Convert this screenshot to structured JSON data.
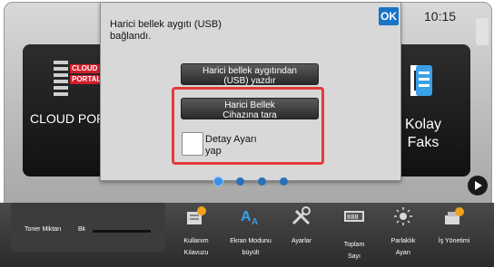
{
  "clock": "10:15",
  "tiles": {
    "cloud_logo_line1": "CLOUD",
    "cloud_logo_line2": "PORTAL",
    "cloud_label": "CLOUD POR",
    "fax_label_1": "Kolay",
    "fax_label_2": "Faks"
  },
  "dialog": {
    "message_line1": "Harici bellek aygıtı (USB)",
    "message_line2": "bağlandı.",
    "ok_label": "OK",
    "print_button_line1": "Harici bellek aygıtından",
    "print_button_line2": "(USB) yazdır",
    "scan_button_line1": "Harici Bellek",
    "scan_button_line2": "Cihazına tara",
    "detail_label_line1": "Detay Ayarı",
    "detail_label_line2": "yap",
    "highlight_color": "#e53a3a"
  },
  "pagination": {
    "pages": 4,
    "active": 1
  },
  "toner": {
    "label": "Toner Miktarı",
    "channel": "Bk",
    "level": 1.0
  },
  "functions": [
    {
      "label1": "Kullanım",
      "label2": "Kılavuzu",
      "icon": "manual-icon"
    },
    {
      "label1": "Ekran Modunu",
      "label2": "büyült",
      "icon": "text-size-icon"
    },
    {
      "label1": "Ayarlar",
      "label2": "",
      "icon": "settings-tools-icon"
    },
    {
      "label1": "Toplam",
      "label2": "Sayı",
      "icon": "counter-icon"
    },
    {
      "label1": "Parlaklık",
      "label2": "Ayarı",
      "icon": "brightness-icon"
    },
    {
      "label1": "İş Yönetimi",
      "label2": "",
      "icon": "job-status-icon"
    }
  ]
}
